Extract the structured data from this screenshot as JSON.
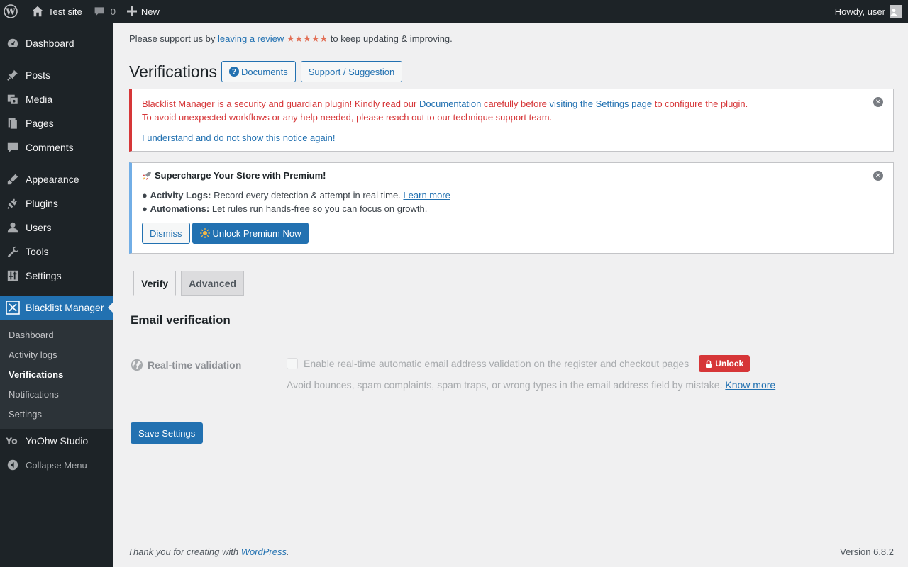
{
  "adminbar": {
    "site_name": "Test site",
    "comments_count": "0",
    "new_label": "New",
    "howdy": "Howdy, user"
  },
  "sidebar": {
    "items": [
      {
        "label": "Dashboard",
        "icon": "dashboard-icon"
      },
      {
        "label": "Posts",
        "icon": "pin-icon"
      },
      {
        "label": "Media",
        "icon": "media-icon"
      },
      {
        "label": "Pages",
        "icon": "pages-icon"
      },
      {
        "label": "Comments",
        "icon": "comment-icon"
      },
      {
        "label": "Appearance",
        "icon": "brush-icon"
      },
      {
        "label": "Plugins",
        "icon": "plug-icon"
      },
      {
        "label": "Users",
        "icon": "user-icon"
      },
      {
        "label": "Tools",
        "icon": "wrench-icon"
      },
      {
        "label": "Settings",
        "icon": "settings-icon"
      },
      {
        "label": "Blacklist Manager",
        "icon": "blacklist-icon"
      }
    ],
    "submenu": [
      "Dashboard",
      "Activity logs",
      "Verifications",
      "Notifications",
      "Settings"
    ],
    "yoohw": "YoOhw Studio",
    "collapse": "Collapse Menu"
  },
  "support": {
    "prefix": "Please support us by",
    "link": "leaving a review",
    "stars": "★★★★★",
    "suffix": "to keep updating & improving."
  },
  "header": {
    "title": "Verifications",
    "documents": "Documents",
    "support": "Support / Suggestion"
  },
  "notice_error": {
    "t1": "Blacklist Manager is a security and guardian plugin! Kindly read our",
    "link1": "Documentation",
    "t2": "carefully before",
    "link2": "visiting the Settings page",
    "t3": "to configure the plugin.",
    "line2": "To avoid unexpected workflows or any help needed, please reach out to our technique support team.",
    "dismiss_link": "I understand and do not show this notice again!"
  },
  "notice_premium": {
    "title": "Supercharge Your Store with Premium!",
    "bullet1_label": "Activity Logs:",
    "bullet1_text": "Record every detection & attempt in real time.",
    "bullet1_link": "Learn more",
    "bullet2_label": "Automations:",
    "bullet2_text": "Let rules run hands-free so you can focus on growth.",
    "dismiss": "Dismiss",
    "unlock": "Unlock Premium Now"
  },
  "tabs": [
    "Verify",
    "Advanced"
  ],
  "section": {
    "title": "Email verification",
    "field_label": "Real-time validation",
    "checkbox_label": "Enable real-time automatic email address validation on the register and checkout pages",
    "unlock": "Unlock",
    "description": "Avoid bounces, spam complaints, spam traps, or wrong types in the email address field by mistake.",
    "know_more": "Know more",
    "save": "Save Settings"
  },
  "footer": {
    "thanks_prefix": "Thank you for creating with",
    "thanks_link": "WordPress",
    "version": "Version 6.8.2"
  },
  "colors": {
    "admin_bg": "#1d2327",
    "accent": "#2271b1",
    "error": "#d63638",
    "info": "#72aee6"
  }
}
